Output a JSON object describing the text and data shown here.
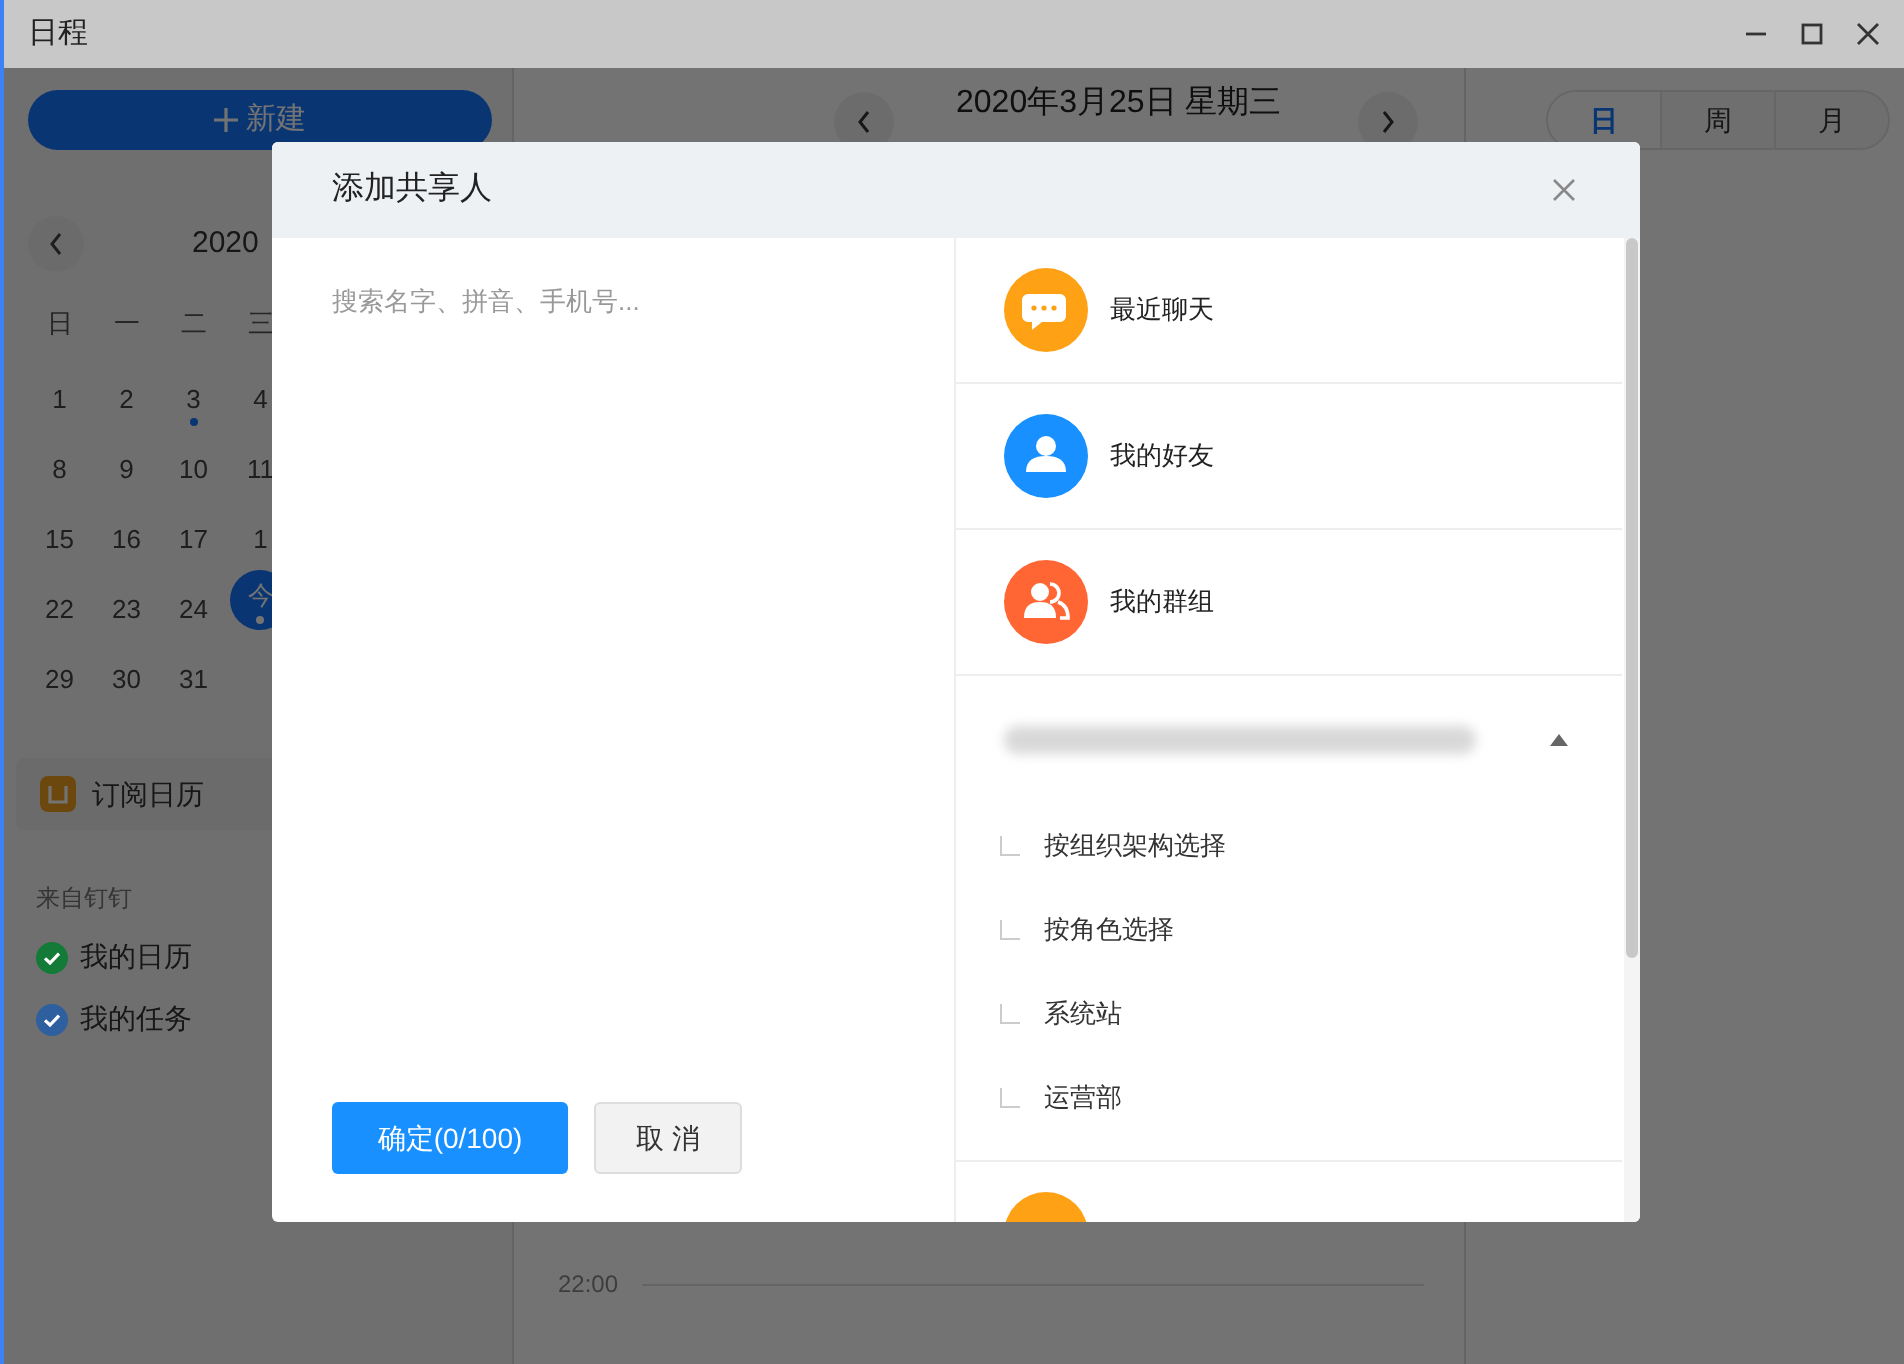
{
  "window": {
    "title": "日程"
  },
  "sidebar": {
    "new_button": "新建",
    "month_label": "2020",
    "weekdays": [
      "日",
      "一",
      "二",
      "三"
    ],
    "weeks": [
      [
        {
          "day": "1",
          "has_event": false,
          "selected": false
        },
        {
          "day": "2",
          "has_event": false,
          "selected": false
        },
        {
          "day": "3",
          "has_event": true,
          "selected": false
        },
        {
          "day": "4",
          "has_event": false,
          "selected": false
        }
      ],
      [
        {
          "day": "8",
          "has_event": false,
          "selected": false
        },
        {
          "day": "9",
          "has_event": false,
          "selected": false
        },
        {
          "day": "10",
          "has_event": false,
          "selected": false
        },
        {
          "day": "11",
          "has_event": false,
          "selected": false
        }
      ],
      [
        {
          "day": "15",
          "has_event": false,
          "selected": false
        },
        {
          "day": "16",
          "has_event": false,
          "selected": false
        },
        {
          "day": "17",
          "has_event": false,
          "selected": false
        },
        {
          "day": "1",
          "has_event": false,
          "selected": false
        }
      ],
      [
        {
          "day": "22",
          "has_event": false,
          "selected": false
        },
        {
          "day": "23",
          "has_event": false,
          "selected": false
        },
        {
          "day": "24",
          "has_event": false,
          "selected": false
        },
        {
          "day": "今",
          "has_event": true,
          "selected": true
        }
      ],
      [
        {
          "day": "29",
          "has_event": false,
          "selected": false
        },
        {
          "day": "30",
          "has_event": false,
          "selected": false
        },
        {
          "day": "31",
          "has_event": false,
          "selected": false
        }
      ]
    ],
    "subscribe_button": "订阅日历",
    "source_label": "来自钉钉",
    "calendars": [
      {
        "label": "我的日历",
        "checked": true,
        "color": "#137a37"
      },
      {
        "label": "我的任务",
        "checked": true,
        "color": "#2e5f9e"
      }
    ]
  },
  "main": {
    "date_title": "2020年3月25日 星期三",
    "view_tabs": [
      {
        "label": "日",
        "selected": true
      },
      {
        "label": "周",
        "selected": false
      },
      {
        "label": "月",
        "selected": false
      }
    ],
    "time_label": "22:00"
  },
  "dialog": {
    "title": "添加共享人",
    "search": {
      "placeholder": "搜索名字、拼音、手机号..."
    },
    "confirm_button": "确定(0/100)",
    "cancel_button": "取 消",
    "categories": [
      {
        "label": "最近聊天",
        "kind": "chat",
        "color": "#ffa115"
      },
      {
        "label": "我的好友",
        "kind": "friend",
        "color": "#1890ff"
      },
      {
        "label": "我的群组",
        "kind": "group",
        "color": "#ff6634"
      }
    ],
    "organization": {
      "expanded": true,
      "items": [
        "按组织架构选择",
        "按角色选择",
        "系统站",
        "运营部"
      ]
    }
  }
}
